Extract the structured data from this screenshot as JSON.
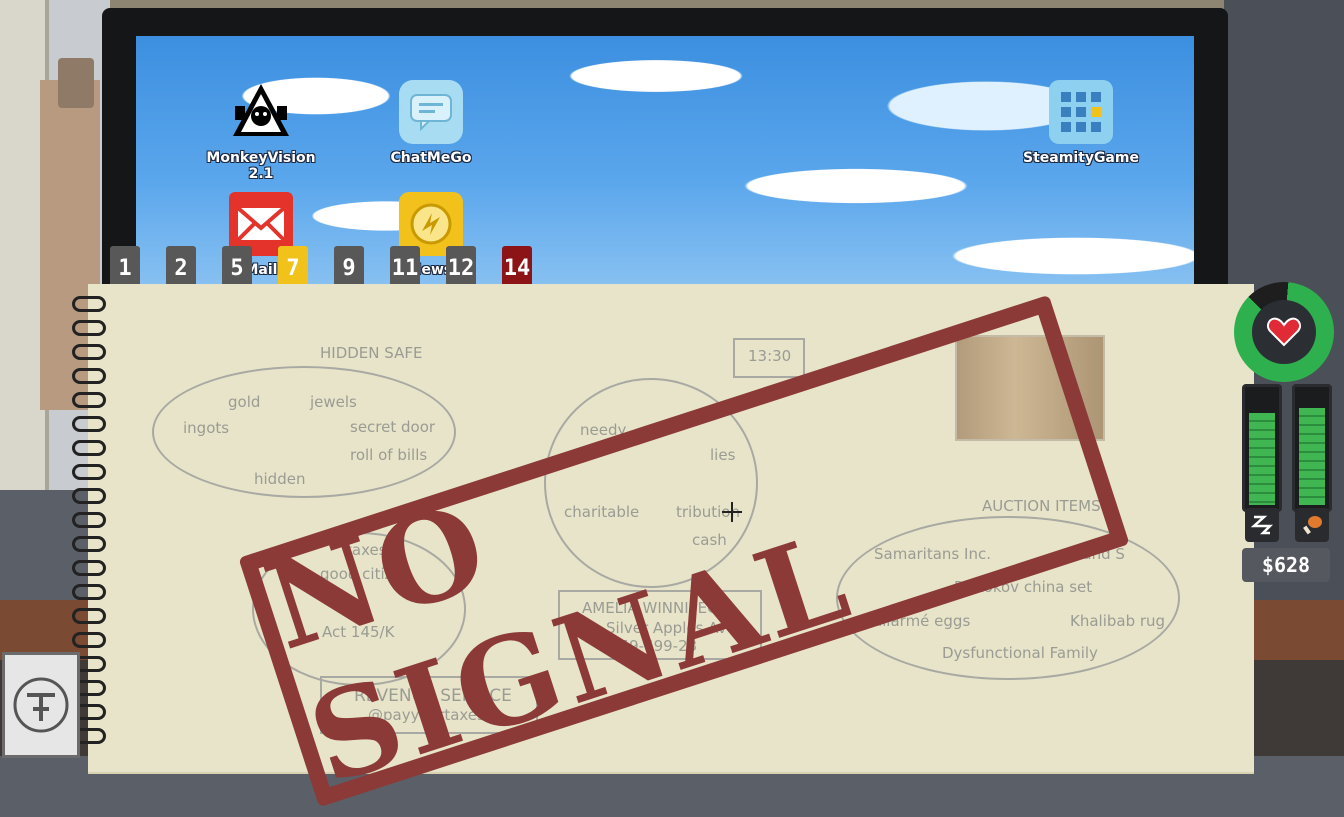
{
  "desktop": {
    "icons": [
      {
        "label": "MonkeyVision 2.1",
        "icon": "monkey-icon"
      },
      {
        "label": "ChatMeGo",
        "icon": "chat-icon"
      },
      {
        "label": "SteamityGame",
        "icon": "grid-icon"
      },
      {
        "label": "Mail",
        "icon": "mail-icon"
      },
      {
        "label": "News",
        "icon": "news-icon"
      }
    ]
  },
  "tabs": [
    "1",
    "2",
    "5",
    "7",
    "9",
    "11",
    "12",
    "14"
  ],
  "notebook": {
    "time_box": "13:30",
    "hidden_safe": {
      "title": "HIDDEN SAFE",
      "items": [
        "gold",
        "jewels",
        "ingots",
        "secret door",
        "roll of bills",
        "hidden"
      ]
    },
    "center_bubble": {
      "items": [
        "needy",
        "lies",
        "charitable",
        "tribution",
        "cash"
      ]
    },
    "left_bubble": {
      "items": [
        "taxes",
        "good citizen",
        "Act 145/K"
      ]
    },
    "auction": {
      "title": "AUCTION ITEMS",
      "items": [
        "Samaritans Inc.",
        "G and S",
        "Protokov china set",
        "Mallarmé eggs",
        "Khalibab rug",
        "Dysfunctional Family"
      ]
    },
    "address": {
      "name": "AMELIA WINNIPEG",
      "street": "Silver Apples Ave.",
      "phone": "659-699-23"
    },
    "revenue": {
      "title": "REVENUE SERVICE",
      "handle": "@payyourtaxes"
    }
  },
  "stamp_text": "NO SIGNAL",
  "hud": {
    "money": "$628",
    "health_icon": "heart-icon",
    "sleep_icon": "sleep-icon",
    "food_icon": "food-icon",
    "sleep_level": 0.85,
    "food_level": 0.9,
    "health_level": 0.88
  },
  "colors": {
    "sky": "#5aa6ec",
    "paper": "#e8e4c9",
    "stamp": "#8b3a38",
    "meter": "#3fb652"
  }
}
